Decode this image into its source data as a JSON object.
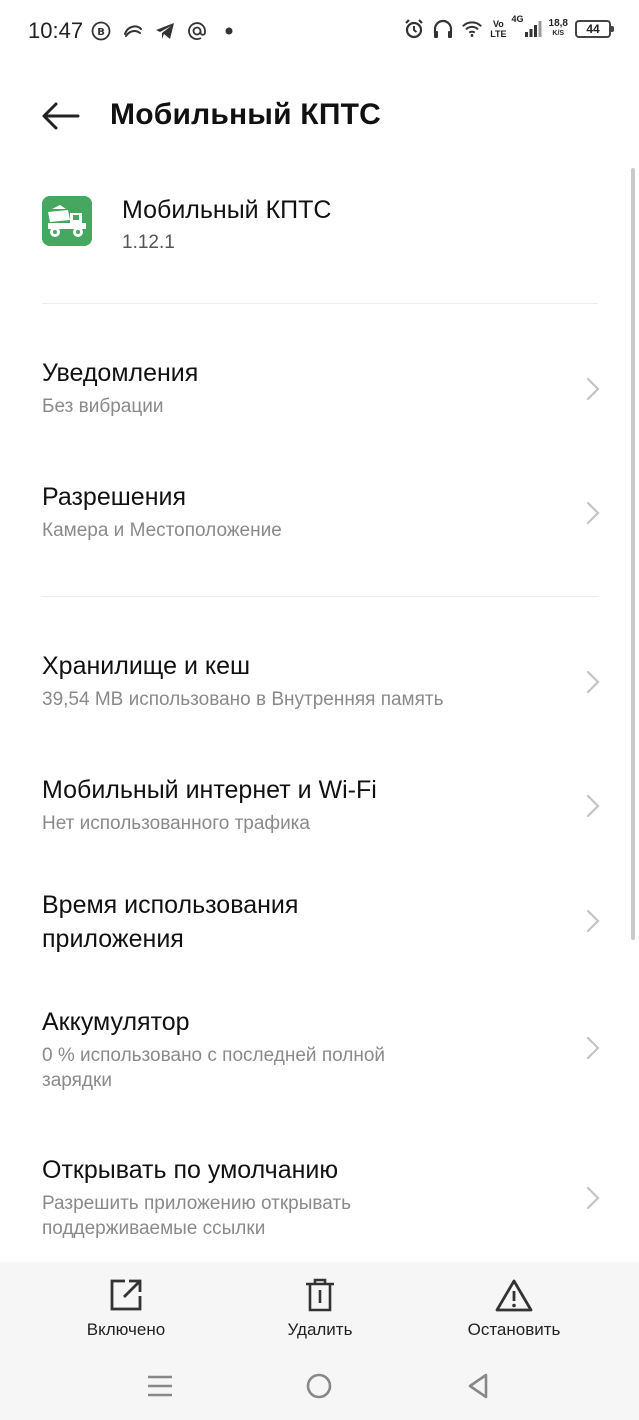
{
  "status_bar": {
    "time": "10:47",
    "left_icons": [
      "vk-icon",
      "swirl-icon",
      "telegram-icon",
      "at-icon",
      "dot-icon"
    ],
    "volte_top": "Vo",
    "volte_bottom": "LTE",
    "network": "4G",
    "speed_value": "18,8",
    "speed_unit": "K/S",
    "battery": "44"
  },
  "header": {
    "title": "Мобильный КПТС"
  },
  "app": {
    "name": "Мобильный КПТС",
    "version": "1.12.1",
    "icon_color": "#46a860"
  },
  "settings": [
    {
      "title": "Уведомления",
      "subtitle": "Без вибрации"
    },
    {
      "title": "Разрешения",
      "subtitle": "Камера и Местоположение"
    },
    {
      "title": "Хранилище и кеш",
      "subtitle": "39,54 MB использовано в Внутренняя память"
    },
    {
      "title": "Мобильный интернет и Wi-Fi",
      "subtitle": "Нет использованного трафика"
    },
    {
      "title_line1": "Время использования",
      "title_line2": "приложения"
    },
    {
      "title": "Аккумулятор",
      "subtitle_line1": "0 % использовано с последней полной",
      "subtitle_line2": "зарядки"
    },
    {
      "title": "Открывать по умолчанию",
      "subtitle_line1": "Разрешить приложению открывать",
      "subtitle_line2": "поддерживаемые ссылки"
    }
  ],
  "actions": {
    "enabled": "Включено",
    "delete": "Удалить",
    "stop": "Остановить"
  },
  "nav": {
    "icons": [
      "menu-icon",
      "home-circle-icon",
      "back-triangle-icon"
    ]
  }
}
